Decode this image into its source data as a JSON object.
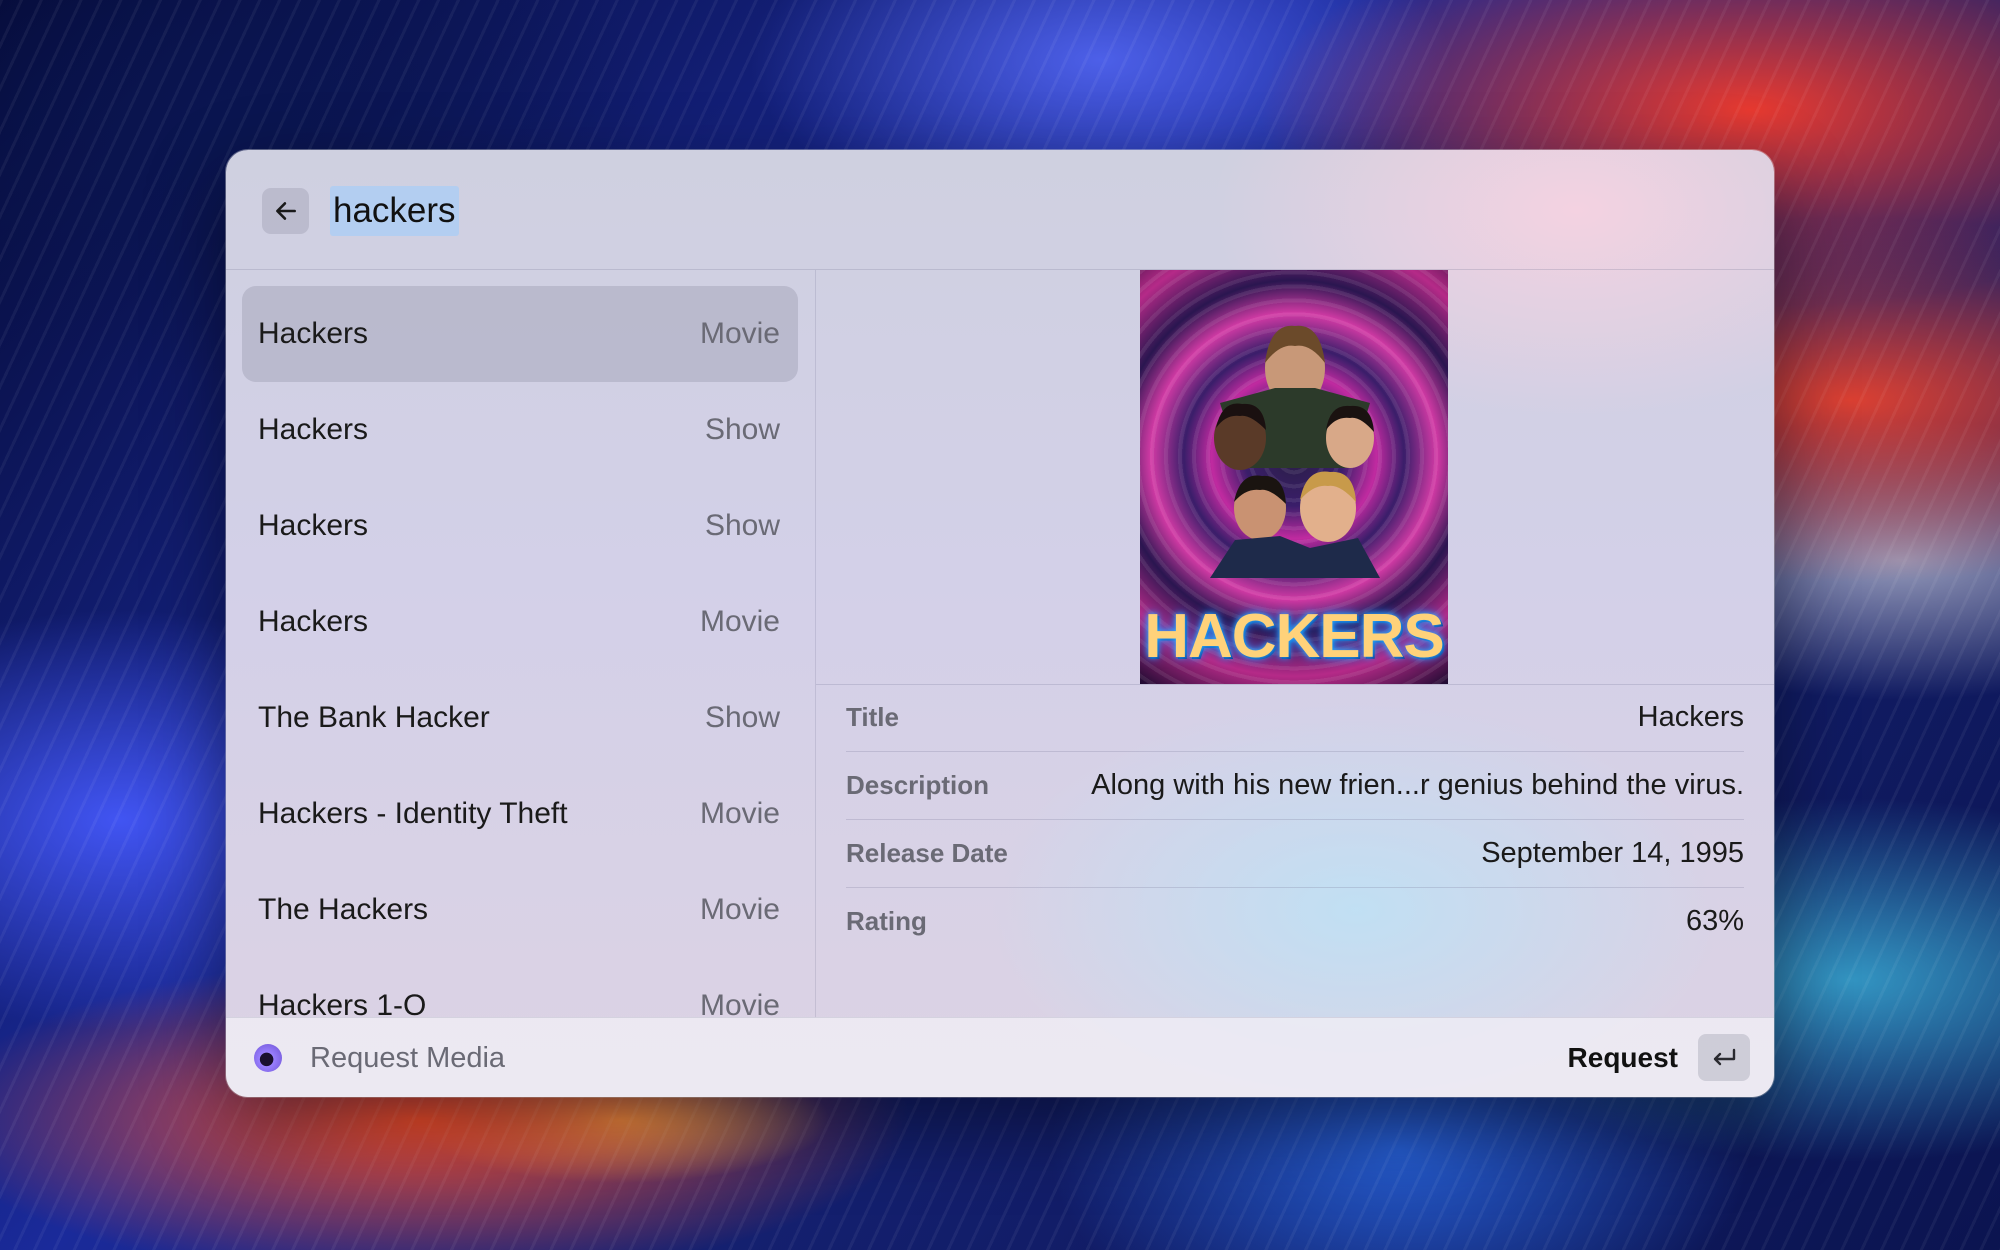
{
  "search": {
    "query": "hackers"
  },
  "results": [
    {
      "title": "Hackers",
      "type": "Movie",
      "selected": true
    },
    {
      "title": "Hackers",
      "type": "Show"
    },
    {
      "title": "Hackers",
      "type": "Show"
    },
    {
      "title": "Hackers",
      "type": "Movie"
    },
    {
      "title": "The Bank Hacker",
      "type": "Show"
    },
    {
      "title": "Hackers - Identity Theft",
      "type": "Movie"
    },
    {
      "title": "The Hackers",
      "type": "Movie"
    },
    {
      "title": "Hackers 1-O",
      "type": "Movie"
    }
  ],
  "detail": {
    "poster_text": "HACKERS",
    "metadata": [
      {
        "label": "Title",
        "value": "Hackers"
      },
      {
        "label": "Description",
        "value": "Along with his new frien...r genius behind the virus."
      },
      {
        "label": "Release Date",
        "value": "September 14, 1995"
      },
      {
        "label": "Rating",
        "value": "63%"
      }
    ]
  },
  "footer": {
    "command_name": "Request Media",
    "primary_action": "Request",
    "icons": {
      "extension": "request-media-icon",
      "enter": "enter-key-icon",
      "back": "arrow-left-icon"
    }
  },
  "colors": {
    "selection": "#aac5f0",
    "highlight_row": "#b5b4c6"
  }
}
